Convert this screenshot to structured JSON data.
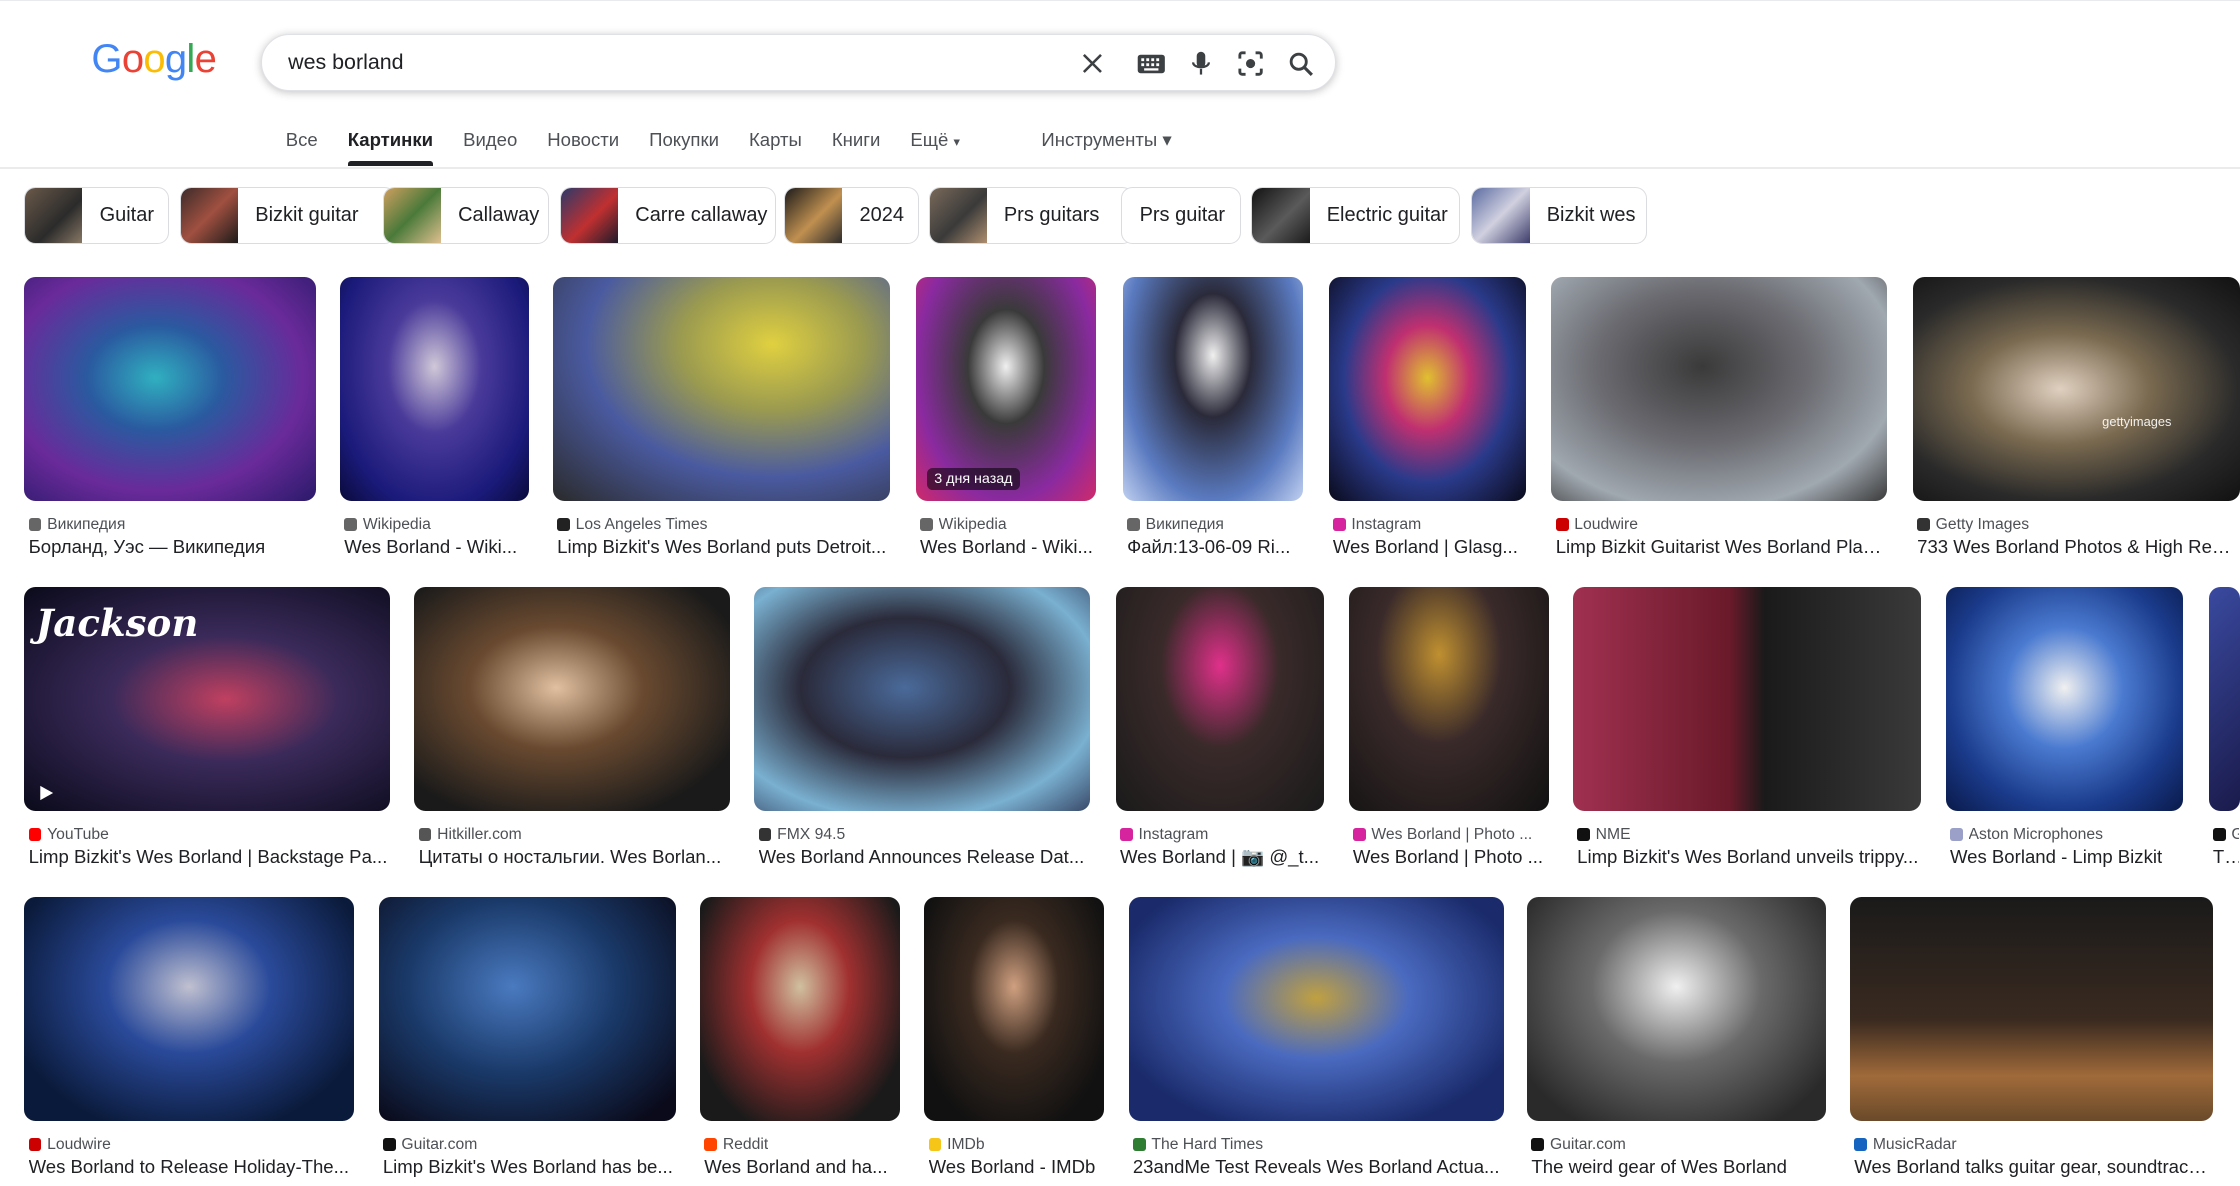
{
  "search": {
    "query": "wes borland"
  },
  "logo": {
    "letters": [
      "G",
      "o",
      "o",
      "g",
      "l",
      "e"
    ],
    "colors": [
      "#4285F4",
      "#EA4335",
      "#FBBC05",
      "#4285F4",
      "#34A853",
      "#EA4335"
    ]
  },
  "icons": [
    "clear-icon",
    "keyboard-icon",
    "mic-icon",
    "lens-icon",
    "search-icon"
  ],
  "tabs": [
    "Все",
    "Картинки",
    "Видео",
    "Новости",
    "Покупки",
    "Карты",
    "Книги",
    "Ещё"
  ],
  "tabs_more_caret": "▾",
  "tools_label": "Инструменты ▾",
  "chips": [
    "Guitar",
    "Bizkit guitar",
    "Callaway",
    "Carre callaway",
    "2024",
    "Prs guitars",
    "Prs guitar",
    "Electric guitar",
    "Bizkit wes"
  ],
  "row1": [
    {
      "source": "Википедия",
      "title": "Борланд, Уэс — Википедия",
      "fav": "#666666"
    },
    {
      "source": "Wikipedia",
      "title": "Wes Borland - Wiki...",
      "fav": "#666666"
    },
    {
      "source": "Los Angeles Times",
      "title": "Limp Bizkit's Wes Borland puts Detroit...",
      "fav": "#222222"
    },
    {
      "source": "Wikipedia",
      "title": "Wes Borland - Wiki...",
      "fav": "#666666",
      "badge": "3 дня назад"
    },
    {
      "source": "Википедия",
      "title": "Файл:13-06-09 Ri...",
      "fav": "#666666"
    },
    {
      "source": "Instagram",
      "title": "Wes Borland | Glasg...",
      "fav": "#d6249f"
    },
    {
      "source": "Loudwire",
      "title": "Limp Bizkit Guitarist Wes Borland Play...",
      "fav": "#cc0000"
    },
    {
      "source": "Getty Images",
      "title": "733 Wes Borland Photos & High Res ...",
      "fav": "#333333"
    }
  ],
  "row2": [
    {
      "source": "YouTube",
      "title": "Limp Bizkit's Wes Borland | Backstage Pa...",
      "fav": "#ff0000"
    },
    {
      "source": "Hitkiller.com",
      "title": "Цитаты о ностальгии. Wes Borlan...",
      "fav": "#555555"
    },
    {
      "source": "FMX 94.5",
      "title": "Wes Borland Announces Release Dat...",
      "fav": "#333333"
    },
    {
      "source": "Instagram",
      "title": "Wes Borland | 📷 @_t...",
      "fav": "#d6249f"
    },
    {
      "source": "Wes Borland | Photo ...",
      "title": "Wes Borland | Photo ...",
      "fav": "#d6249f"
    },
    {
      "source": "NME",
      "title": "Limp Bizkit's Wes Borland unveils trippy...",
      "fav": "#111111"
    },
    {
      "source": "Aston Microphones",
      "title": "Wes Borland - Limp Bizkit",
      "fav": "#9aa0c8"
    },
    {
      "source": "G",
      "title": "The",
      "fav": "#111111"
    }
  ],
  "row3": [
    {
      "source": "Loudwire",
      "title": "Wes Borland to Release Holiday-The...",
      "fav": "#cc0000"
    },
    {
      "source": "Guitar.com",
      "title": "Limp Bizkit's Wes Borland has be...",
      "fav": "#111111"
    },
    {
      "source": "Reddit",
      "title": "Wes Borland and ha...",
      "fav": "#ff4500"
    },
    {
      "source": "IMDb",
      "title": "Wes Borland - IMDb",
      "fav": "#f5c518"
    },
    {
      "source": "The Hard Times",
      "title": "23andMe Test Reveals Wes Borland Actua...",
      "fav": "#2e7d32"
    },
    {
      "source": "Guitar.com",
      "title": "The weird gear of Wes Borland",
      "fav": "#111111"
    },
    {
      "source": "MusicRadar",
      "title": "Wes Borland talks guitar gear, soundtrack...",
      "fav": "#1565c0"
    }
  ],
  "image_watermarks": {
    "jackson_logo": "Jackson",
    "getty_logo": "gettyimages"
  }
}
